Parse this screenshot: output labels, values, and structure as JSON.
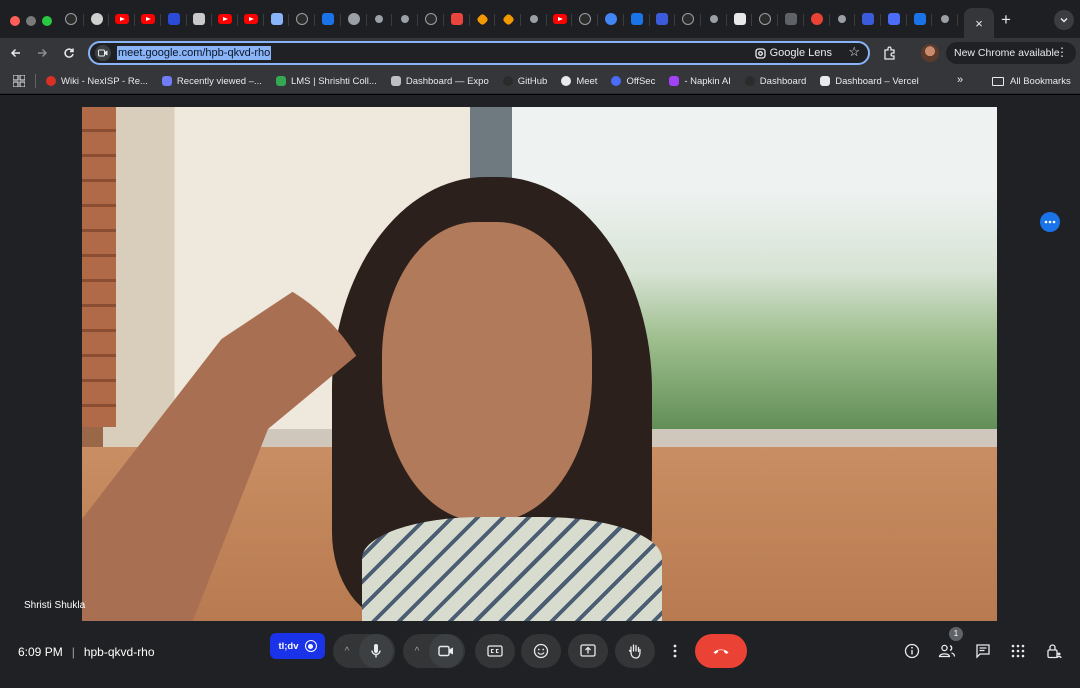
{
  "browser": {
    "active_tab_close": "×",
    "new_tab": "+",
    "url": "meet.google.com/hpb-qkvd-rho",
    "lens_label": "Google Lens",
    "update_label": "New Chrome available",
    "update_menu": "⋮"
  },
  "tabs": [
    {
      "icon": "github-icon",
      "color": "#2b2b2b"
    },
    {
      "icon": "white-circle-icon",
      "color": "#d0d0d0"
    },
    {
      "icon": "youtube-icon",
      "color": "#ff0000"
    },
    {
      "icon": "youtube-icon",
      "color": "#ff0000"
    },
    {
      "icon": "chevron-v-icon",
      "color": "#2a4bd7"
    },
    {
      "icon": "document-icon",
      "color": "#c9c9c9"
    },
    {
      "icon": "youtube-icon",
      "color": "#ff0000"
    },
    {
      "icon": "youtube-icon",
      "color": "#ff0000"
    },
    {
      "icon": "hexagon-icon",
      "color": "#8ab4f8"
    },
    {
      "icon": "github-icon",
      "color": "#2b2b2b"
    },
    {
      "icon": "x-cross-icon",
      "color": "#1a73e8"
    },
    {
      "icon": "globe-icon",
      "color": "#9aa0a6"
    },
    {
      "icon": "dot-icon",
      "color": "#9aa0a6"
    },
    {
      "icon": "dot-icon",
      "color": "#9aa0a6"
    },
    {
      "icon": "github-icon",
      "color": "#2b2b2b"
    },
    {
      "icon": "slash-icon",
      "color": "#e8453c"
    },
    {
      "icon": "diamond-icon",
      "color": "#f29900"
    },
    {
      "icon": "diamond-icon",
      "color": "#f29900"
    },
    {
      "icon": "dot-icon",
      "color": "#9aa0a6"
    },
    {
      "icon": "youtube-icon",
      "color": "#ff0000"
    },
    {
      "icon": "github-icon",
      "color": "#2b2b2b"
    },
    {
      "icon": "blue-ring-icon",
      "color": "#4285f4"
    },
    {
      "icon": "blue-square-icon",
      "color": "#1a73e8"
    },
    {
      "icon": "blue-e-icon",
      "color": "#3b5bdb"
    },
    {
      "icon": "github-icon",
      "color": "#2b2b2b"
    },
    {
      "icon": "dot-icon",
      "color": "#9aa0a6"
    },
    {
      "icon": "white-square-icon",
      "color": "#e8e8e8"
    },
    {
      "icon": "github-icon",
      "color": "#2b2b2b"
    },
    {
      "icon": "slash-icon",
      "color": "#5f6368"
    },
    {
      "icon": "red-dot-icon",
      "color": "#ea4335"
    },
    {
      "icon": "dot-icon",
      "color": "#9aa0a6"
    },
    {
      "icon": "s-logo-icon",
      "color": "#3b5bdb"
    },
    {
      "icon": "x-box-icon",
      "color": "#4a6cf7"
    },
    {
      "icon": "x-cross-icon",
      "color": "#1a73e8"
    },
    {
      "icon": "dot-icon",
      "color": "#9aa0a6"
    }
  ],
  "bookmarks": {
    "items": [
      {
        "label": "Wiki - NexISP - Re...",
        "color": "#d93025"
      },
      {
        "label": "Recently viewed –...",
        "color": "#6f7cf6"
      },
      {
        "label": "LMS | Shrishti Coll...",
        "color": "#34a853"
      },
      {
        "label": "Dashboard — Expo",
        "color": "#bdc1c6"
      },
      {
        "label": "GitHub",
        "color": "#2b2b2b"
      },
      {
        "label": "Meet",
        "color": "#e8eaed"
      },
      {
        "label": "OffSec",
        "color": "#4a6cf7"
      },
      {
        "label": "- Napkin AI",
        "color": "#a142f4"
      },
      {
        "label": "Dashboard",
        "color": "#2b2b2b"
      },
      {
        "label": "Dashboard – Vercel",
        "color": "#e8eaed"
      }
    ],
    "overflow": "»",
    "all_label": "All Bookmarks"
  },
  "meet": {
    "participant_name": "Shristi Shukla",
    "time": "6:09 PM",
    "separator": "|",
    "meeting_code": "hpb-qkvd-rho",
    "tldv_label": "tl;dv",
    "people_count": "1",
    "caret": "^"
  }
}
